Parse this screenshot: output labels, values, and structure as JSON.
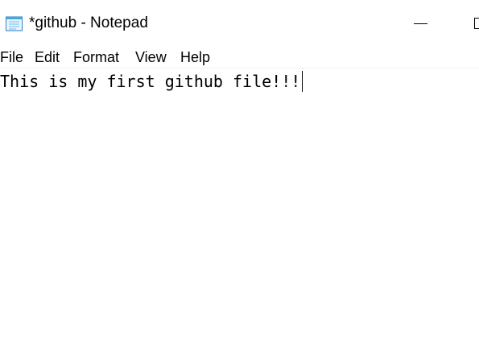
{
  "window": {
    "title": "*github - Notepad"
  },
  "menu": {
    "items": [
      "File",
      "Edit",
      "Format",
      "View",
      "Help"
    ]
  },
  "editor": {
    "content": "This is my first github file!!!"
  },
  "icons": {
    "app": "notepad-icon",
    "minimize": "minimize-icon",
    "maximize": "maximize-icon"
  }
}
